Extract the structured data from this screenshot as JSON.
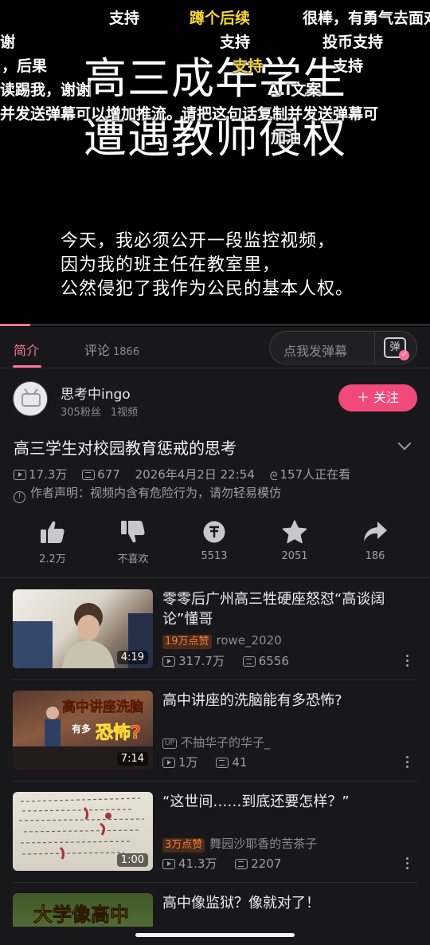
{
  "video": {
    "title_line1": "高三成年学生",
    "title_line2": "遭遇教师侵权",
    "subtitle_lines": [
      "今天，我必须公开一段监控视频，",
      "因为我的班主任在教室里，",
      "公然侵犯了我作为公民的基本人权。"
    ],
    "progress_fraction": 0.07,
    "danmaku": [
      {
        "text": "支持",
        "color": "white"
      },
      {
        "text": "蹲个后续",
        "color": "yellow"
      },
      {
        "text": "很棒，有勇气去面对",
        "color": "white"
      },
      {
        "text": "谢",
        "color": "white"
      },
      {
        "text": "支持",
        "color": "white"
      },
      {
        "text": "投币支持",
        "color": "white"
      },
      {
        "text": "，后果",
        "color": "white"
      },
      {
        "text": "支持",
        "color": "yellow"
      },
      {
        "text": "支持",
        "color": "white"
      },
      {
        "text": "读踢我，谢谢",
        "color": "white"
      },
      {
        "text": "A.I文案",
        "color": "white"
      },
      {
        "text": "并发送弹幕可以增加推流。请把这句话复制并发送弹幕可",
        "color": "white"
      },
      {
        "text": "加油",
        "color": "white"
      }
    ]
  },
  "tabs": {
    "intro": "简介",
    "comments": "评论",
    "comments_count": "1866",
    "danmaku_placeholder": "点我发弹幕",
    "danmaku_toggle": "弹"
  },
  "uploader": {
    "name": "思考中ingo",
    "fans": "305粉丝",
    "videos": "1视频",
    "follow_label": "＋ 关注"
  },
  "info": {
    "title": "高三学生对校园教育惩戒的思考",
    "views": "17.3万",
    "danmaku_count": "677",
    "date": "2026年4月2日 22:54",
    "watching": "157人正在看",
    "notice": "作者声明：视频内含有危险行为，请勿轻易模仿"
  },
  "actions": [
    {
      "icon": "thumb-up-icon",
      "label": "2.2万"
    },
    {
      "icon": "thumb-down-icon",
      "label": "不喜欢"
    },
    {
      "icon": "coin-icon",
      "label": "5513"
    },
    {
      "icon": "star-icon",
      "label": "2051"
    },
    {
      "icon": "share-icon",
      "label": "186"
    }
  ],
  "recommendations": [
    {
      "title": "零零后广州高三牲硬座怒怼“高谈阔论”懂哥",
      "badge": "19万点赞",
      "up": "rowe_2020",
      "views": "317.7万",
      "danmaku": "6556",
      "duration": "4:19",
      "thumb_text": ""
    },
    {
      "title": "高中讲座的洗脑能有多恐怖?",
      "badge": "",
      "up": "不抽华子的华子_",
      "uptag": "UP",
      "views": "1万",
      "danmaku": "41",
      "duration": "7:14",
      "thumb_text": "高中讲座洗脑 有多 恐怖?"
    },
    {
      "title": "“这世间……到底还要怎样？”",
      "badge": "3万点赞",
      "up": "舞园沙耶香的苦茶子",
      "views": "41.3万",
      "danmaku": "2207",
      "duration": "1:00",
      "thumb_text": ""
    },
    {
      "title": "高中像监狱？像就对了！",
      "thumb_text": "大学像高中"
    }
  ],
  "colors": {
    "accent": "#fb7299",
    "follow": "#f2487a",
    "danmaku_yellow": "#f5d63a"
  }
}
